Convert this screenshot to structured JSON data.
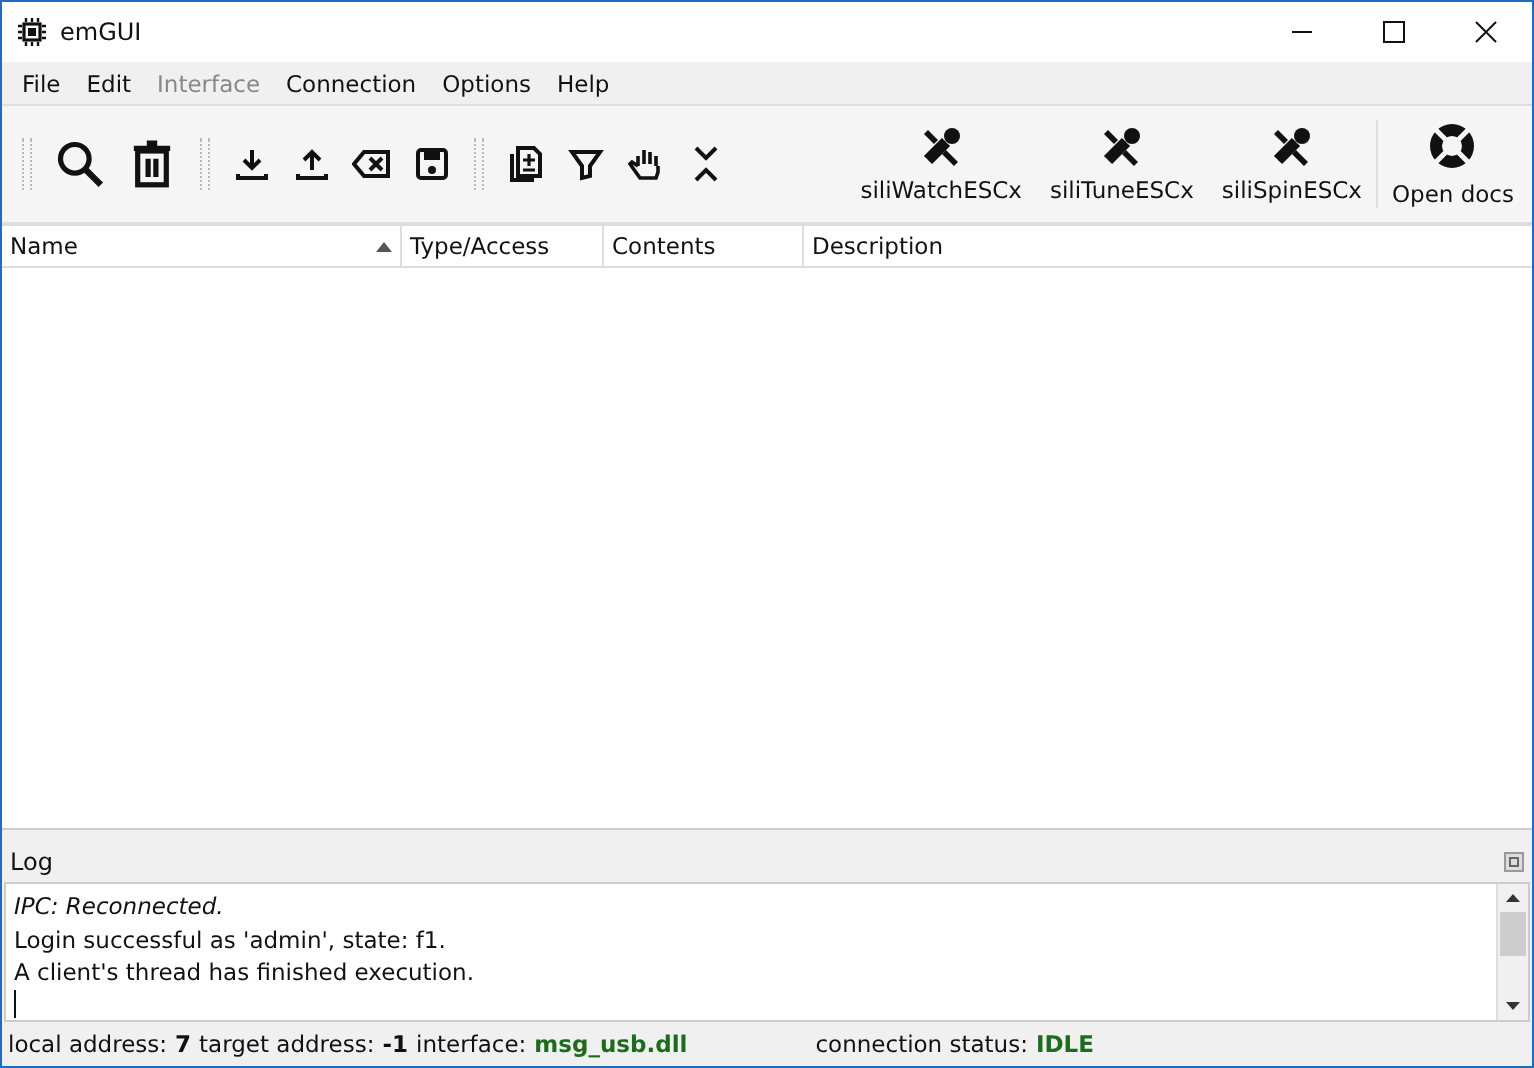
{
  "window": {
    "title": "emGUI"
  },
  "menu": [
    {
      "label": "File",
      "disabled": false
    },
    {
      "label": "Edit",
      "disabled": false
    },
    {
      "label": "Interface",
      "disabled": true
    },
    {
      "label": "Connection",
      "disabled": false
    },
    {
      "label": "Options",
      "disabled": false
    },
    {
      "label": "Help",
      "disabled": false
    }
  ],
  "toolbar": [
    {
      "kind": "search"
    },
    {
      "kind": "trash"
    },
    {
      "kind": "sep"
    },
    {
      "kind": "download"
    },
    {
      "kind": "upload"
    },
    {
      "kind": "backspace"
    },
    {
      "kind": "save"
    },
    {
      "kind": "sep"
    },
    {
      "kind": "copy"
    },
    {
      "kind": "filter"
    },
    {
      "kind": "hand"
    },
    {
      "kind": "collapse"
    },
    {
      "kind": "tool",
      "label": "siliWatchESCx"
    },
    {
      "kind": "tool",
      "label": "siliTuneESCx"
    },
    {
      "kind": "tool",
      "label": "siliSpinESCx"
    },
    {
      "kind": "docs",
      "label": "Open docs"
    }
  ],
  "table": {
    "columns": [
      {
        "label": "Name",
        "sorted": true
      },
      {
        "label": "Type/Access",
        "sorted": false
      },
      {
        "label": "Contents",
        "sorted": false
      },
      {
        "label": "Description",
        "sorted": false
      }
    ]
  },
  "log": {
    "title": "Log",
    "lines": [
      {
        "text": "IPC: Reconnected.",
        "italic": true
      },
      {
        "text": "Login successful as 'admin', state: f1.",
        "italic": false
      },
      {
        "text": "A client's thread has finished execution.",
        "italic": false
      }
    ]
  },
  "status_bar": {
    "address": [
      {
        "text": "local address:",
        "kind": "plain"
      },
      {
        "text": "7",
        "kind": "bold"
      },
      {
        "text": "target address:",
        "kind": "plain"
      },
      {
        "text": "-1",
        "kind": "bold"
      },
      {
        "text": "interface:",
        "kind": "plain"
      },
      {
        "text": "msg_usb.dll",
        "kind": "value"
      }
    ],
    "connection": [
      {
        "text": "connection status:",
        "kind": "plain"
      },
      {
        "text": "IDLE",
        "kind": "value"
      }
    ]
  }
}
